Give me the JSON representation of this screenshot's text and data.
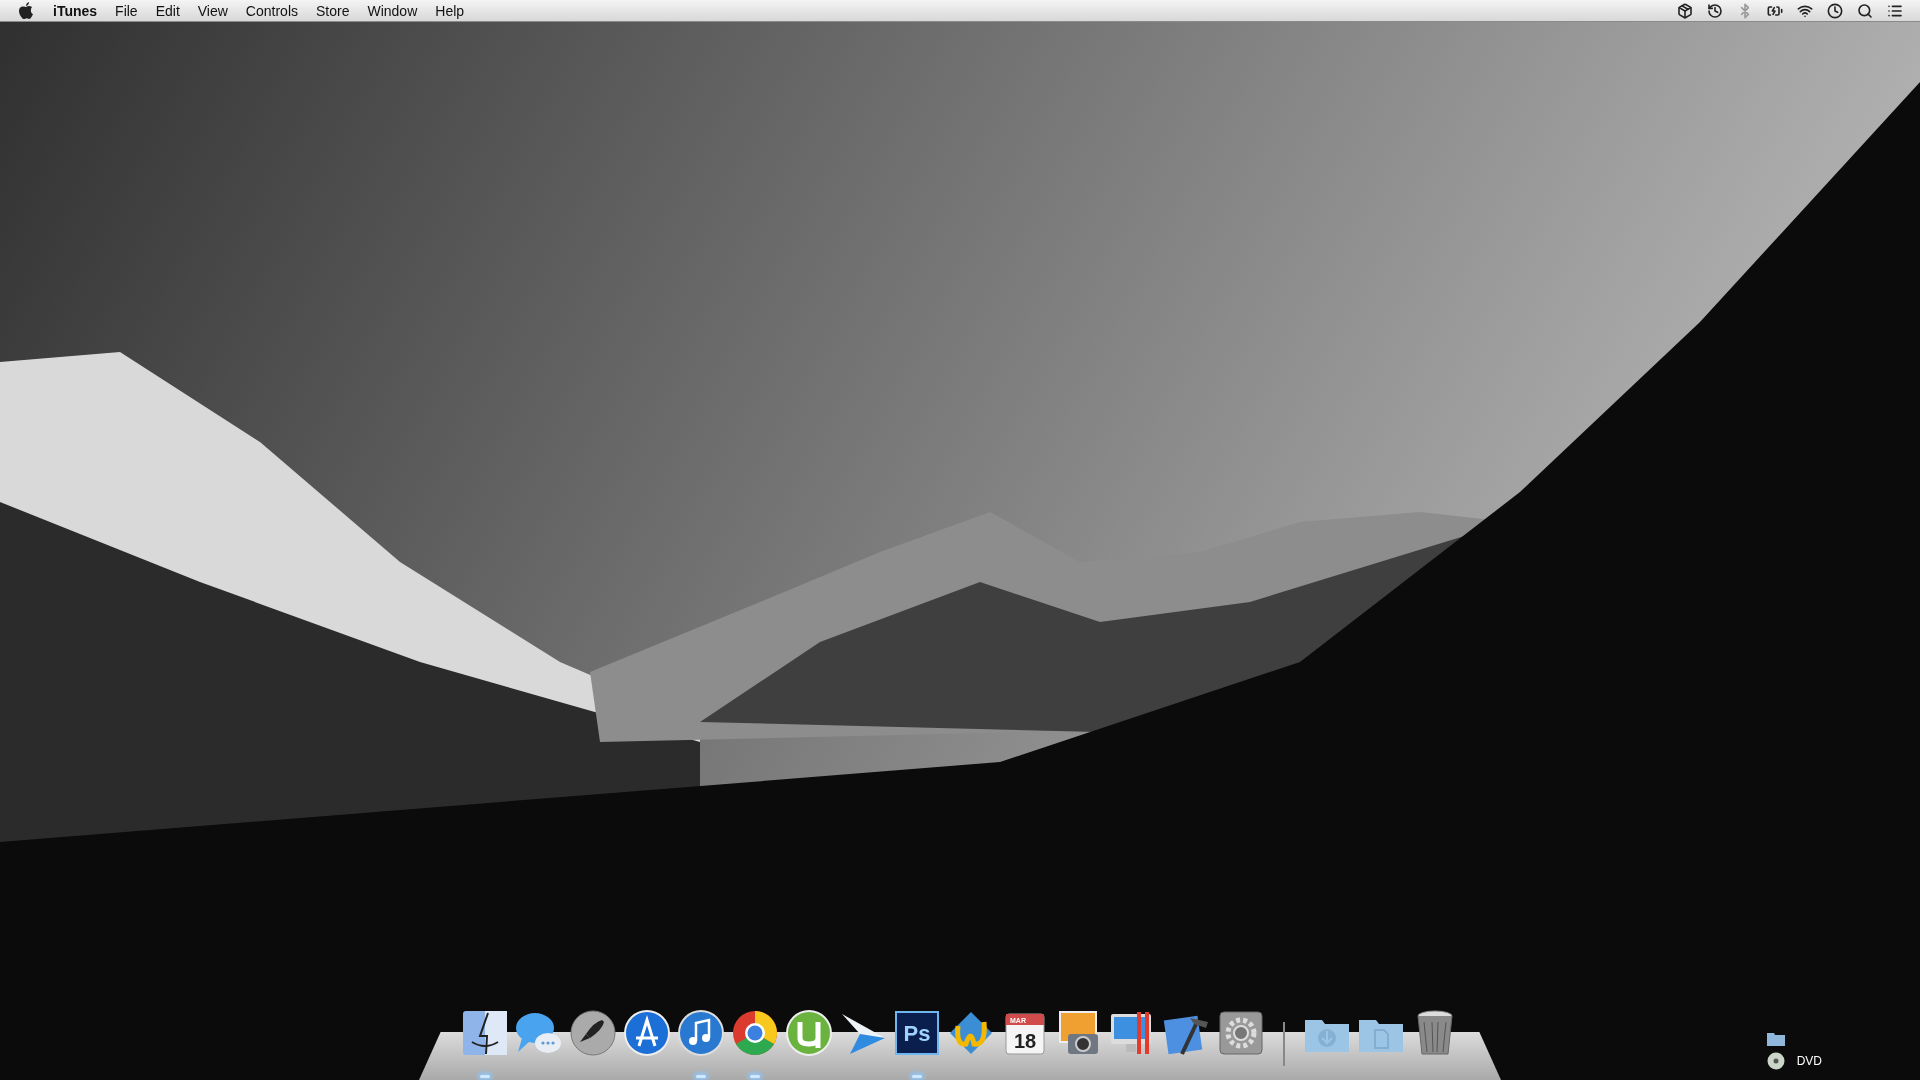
{
  "menu_bar": {
    "app_name": "iTunes",
    "menus": [
      "File",
      "Edit",
      "View",
      "Controls",
      "Store",
      "Window",
      "Help"
    ],
    "status_icons": [
      {
        "kind": "dropbox",
        "disabled": false
      },
      {
        "kind": "timemachine",
        "disabled": false
      },
      {
        "kind": "bluetooth",
        "disabled": true
      },
      {
        "kind": "battery",
        "disabled": false
      },
      {
        "kind": "wifi",
        "disabled": false
      },
      {
        "kind": "clock",
        "disabled": false
      },
      {
        "kind": "search",
        "disabled": false
      },
      {
        "kind": "list",
        "disabled": false
      }
    ]
  },
  "dock": {
    "apps": [
      {
        "kind": "finder",
        "running": true
      },
      {
        "kind": "messages",
        "running": false
      },
      {
        "kind": "launchpad",
        "running": false
      },
      {
        "kind": "appstore",
        "running": false
      },
      {
        "kind": "itunes",
        "running": true
      },
      {
        "kind": "chrome",
        "running": true
      },
      {
        "kind": "utorrent",
        "running": false
      },
      {
        "kind": "sparrow",
        "running": false
      },
      {
        "kind": "photoshop",
        "label": "Ps",
        "running": true
      },
      {
        "kind": "thunderbird",
        "running": false
      },
      {
        "kind": "calendar",
        "month": "MAR",
        "day": "18",
        "running": false
      },
      {
        "kind": "iphoto",
        "running": false
      },
      {
        "kind": "parallels",
        "running": false
      },
      {
        "kind": "xcode",
        "running": false
      },
      {
        "kind": "preferences",
        "running": false
      }
    ],
    "stacks": [
      {
        "kind": "downloads"
      },
      {
        "kind": "documents"
      },
      {
        "kind": "trash"
      }
    ]
  },
  "desktop_items": [
    {
      "kind": "folder"
    },
    {
      "kind": "disc",
      "label": "DVD"
    }
  ]
}
